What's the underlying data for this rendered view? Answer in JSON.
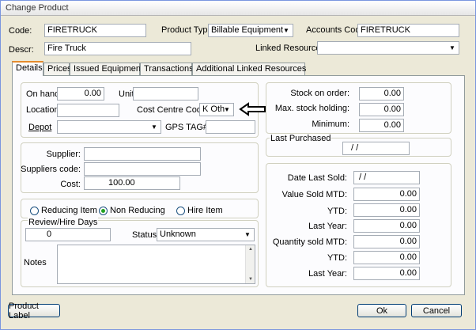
{
  "window": {
    "title": "Change Product"
  },
  "header": {
    "code_label": "Code:",
    "code_value": "FIRETRUCK",
    "product_type_label": "Product Type",
    "product_type_value": "Billable Equipment",
    "accounts_code_label": "Accounts Code:",
    "accounts_code_value": "FIRETRUCK",
    "descr_label": "Descr:",
    "descr_value": "Fire Truck",
    "linked_resource_label": "Linked Resource",
    "linked_resource_value": ""
  },
  "tabs": [
    {
      "label": "Details",
      "active": true
    },
    {
      "label": "Prices",
      "active": false
    },
    {
      "label": "Issued Equipment",
      "active": false
    },
    {
      "label": "Transactions",
      "active": false
    },
    {
      "label": "Additional Linked Resources",
      "active": false
    }
  ],
  "details": {
    "on_hand_label": "On hand:",
    "on_hand_value": "0.00",
    "unit_label": "Unit:",
    "unit_value": "",
    "location_label": "Location:",
    "location_value": "",
    "cost_centre_label": "Cost Centre Code:",
    "cost_centre_value": "K Oth",
    "depot_label": "Depot",
    "depot_value": "",
    "gps_label": "GPS TAG#",
    "gps_value": "",
    "supplier_label": "Supplier:",
    "supplier_value": "",
    "suppliers_code_label": "Suppliers code:",
    "suppliers_code_value": "",
    "cost_label": "Cost:",
    "cost_value": "100.00",
    "radio_reducing": "Reducing Item",
    "radio_non_reducing": "Non Reducing",
    "radio_hire": "Hire Item",
    "selected_radio": "Non Reducing",
    "review_label": "Review/Hire Days",
    "review_value": "0",
    "status_label": "Status",
    "status_value": "Unknown",
    "notes_label": "Notes",
    "notes_value": ""
  },
  "stock": {
    "on_order_label": "Stock on order:",
    "on_order_value": "0.00",
    "max_label": "Max. stock holding:",
    "max_value": "0.00",
    "min_label": "Minimum:",
    "min_value": "0.00",
    "last_purchased_label": "Last Purchased",
    "last_purchased_value": "/ /"
  },
  "sales": {
    "date_last_sold_label": "Date Last Sold:",
    "date_last_sold_value": "/ /",
    "value_sold_mtd_label": "Value Sold MTD:",
    "value_sold_mtd_value": "0.00",
    "ytd1_label": "YTD:",
    "ytd1_value": "0.00",
    "last_year1_label": "Last Year:",
    "last_year1_value": "0.00",
    "qty_sold_mtd_label": "Quantity sold MTD:",
    "qty_sold_mtd_value": "0.00",
    "ytd2_label": "YTD:",
    "ytd2_value": "0.00",
    "last_year2_label": "Last Year:",
    "last_year2_value": "0.00"
  },
  "footer": {
    "product_label_button": "Product Label",
    "ok_button": "Ok",
    "cancel_button": "Cancel"
  },
  "annotation": {
    "icon": "left-arrow-icon"
  },
  "colors": {
    "window_bg": "#ece9d8",
    "tab_accent": "#e68b2c",
    "radio_on": "#21a121"
  }
}
